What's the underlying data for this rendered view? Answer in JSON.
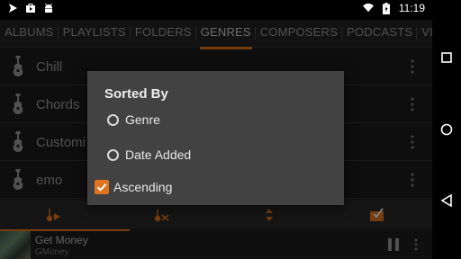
{
  "status": {
    "time": "11:19",
    "icons": [
      "navigation-icon",
      "store-icon",
      "android-icon",
      "wifi-icon",
      "battery-icon"
    ]
  },
  "tabs": [
    {
      "label": "ALBUMS",
      "active": false
    },
    {
      "label": "PLAYLISTS",
      "active": false
    },
    {
      "label": "FOLDERS",
      "active": false
    },
    {
      "label": "GENRES",
      "active": true
    },
    {
      "label": "COMPOSERS",
      "active": false
    },
    {
      "label": "PODCASTS",
      "active": false
    },
    {
      "label": "VIDEO",
      "active": false
    }
  ],
  "genres": [
    {
      "name": "Chill"
    },
    {
      "name": "Chords"
    },
    {
      "name": "Customi"
    },
    {
      "name": "emo"
    }
  ],
  "actions": [
    "play-genre-icon",
    "shuffle-genre-icon",
    "sort-icon",
    "select-all-icon"
  ],
  "now_playing": {
    "title": "Get Money",
    "artist": "GMoney",
    "progress": 0.3
  },
  "dialog": {
    "title": "Sorted By",
    "options": [
      {
        "label": "Genre",
        "selected": false
      },
      {
        "label": "Date Added",
        "selected": false
      }
    ],
    "ascending": {
      "label": "Ascending",
      "checked": true
    }
  },
  "colors": {
    "accent": "#e0741e"
  }
}
